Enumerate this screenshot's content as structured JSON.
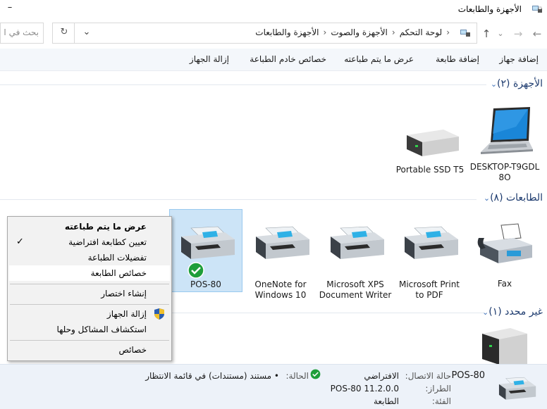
{
  "window": {
    "title": "الأجهزة والطابعات",
    "minimize": "–"
  },
  "nav": {
    "back": "←",
    "forward": "→",
    "recent": "⌄",
    "up": "↑",
    "refresh": "↻",
    "dropdown": "⌄"
  },
  "breadcrumb": {
    "root_sep": "‹",
    "items": [
      "لوحة التحكم",
      "الأجهزة والصوت",
      "الأجهزة والطابعات"
    ],
    "sep": "‹"
  },
  "search": {
    "placeholder": "بحث في ا"
  },
  "toolbar": {
    "add_device": "إضافة جهاز",
    "add_printer": "إضافة طابعة",
    "see_printing": "عرض ما يتم طباعته",
    "print_server": "خصائص خادم الطباعة",
    "remove_device": "إزالة الجهاز"
  },
  "groups": {
    "devices": {
      "title": "الأجهزة (٢)",
      "items": [
        {
          "label1": "DESKTOP-T9GDL",
          "label2": "8O",
          "icon": "laptop-icon"
        },
        {
          "label1": "Portable SSD T5",
          "label2": "",
          "icon": "ssd-icon"
        }
      ]
    },
    "printers": {
      "title": "الطابعات (٨)",
      "items": [
        {
          "label1": "Fax",
          "label2": "",
          "icon": "fax-icon"
        },
        {
          "label1": "Microsoft Print",
          "label2": "to PDF",
          "icon": "printer-icon"
        },
        {
          "label1": "Microsoft XPS",
          "label2": "Document Writer",
          "icon": "printer-icon"
        },
        {
          "label1": "OneNote for",
          "label2": "Windows 10",
          "icon": "printer-icon"
        },
        {
          "label1": "POS-80",
          "label2": "",
          "icon": "printer-icon"
        }
      ]
    },
    "unspecified": {
      "title": "غير محدد (١)"
    }
  },
  "context_menu": {
    "items": [
      {
        "label": "عرض ما يتم طباعته",
        "bold": true
      },
      {
        "label": "تعيين كطابعة افتراضية",
        "checked": true
      },
      {
        "label": "تفضيلات الطباعة"
      },
      {
        "label": "خصائص الطابعة",
        "hover": true
      },
      {
        "label": "إنشاء اختصار"
      },
      {
        "label": "إزالة الجهاز",
        "shield": true
      },
      {
        "label": "استكشاف المشاكل وحلها"
      },
      {
        "label": "خصائص"
      }
    ]
  },
  "details": {
    "name": "POS-80",
    "conn_label": "حالة الاتصال:",
    "conn_value": "الافتراضي",
    "model_label": "الطراز:",
    "model_value": "POS-80 11.2.0.0",
    "category_label": "الفئة:",
    "category_value": "الطابعة",
    "status_label": "الحالة:",
    "status_value": "• مستند (مستندات) في قائمة الانتظار"
  },
  "colors": {
    "accent": "#3c6fb8",
    "selection": "#cce4f7",
    "check_green": "#1e9e3a"
  }
}
